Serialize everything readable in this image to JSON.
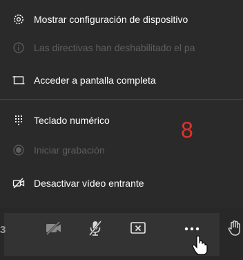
{
  "menu": {
    "items": [
      {
        "label": "Mostrar configuración de dispositivo",
        "icon": "gear-icon",
        "enabled": true
      },
      {
        "label": "Las directivas han deshabilitado el pa",
        "icon": "info-icon",
        "enabled": false
      },
      {
        "label": "Acceder a pantalla completa",
        "icon": "fullscreen-icon",
        "enabled": true
      },
      {
        "label": "Teclado numérico",
        "icon": "dialpad-icon",
        "enabled": true
      },
      {
        "label": "Iniciar grabación",
        "icon": "record-icon",
        "enabled": false
      },
      {
        "label": "Desactivar vídeo entrante",
        "icon": "video-off-icon",
        "enabled": true
      }
    ]
  },
  "annotation": {
    "text": "8",
    "color": "#e0322c"
  },
  "toolbar": {
    "edge_text": "3",
    "buttons": [
      {
        "name": "camera-off-button",
        "icon": "camera-off-icon"
      },
      {
        "name": "mic-off-button",
        "icon": "mic-off-icon"
      },
      {
        "name": "stop-sharing-button",
        "icon": "stop-share-icon"
      },
      {
        "name": "more-actions-button",
        "icon": "more-dots-icon"
      },
      {
        "name": "raise-hand-button",
        "icon": "hand-icon"
      }
    ]
  },
  "colors": {
    "background": "#2b2a2a",
    "text": "#ffffff",
    "disabled_text": "#5f5e5e",
    "annotation": "#e0322c"
  }
}
